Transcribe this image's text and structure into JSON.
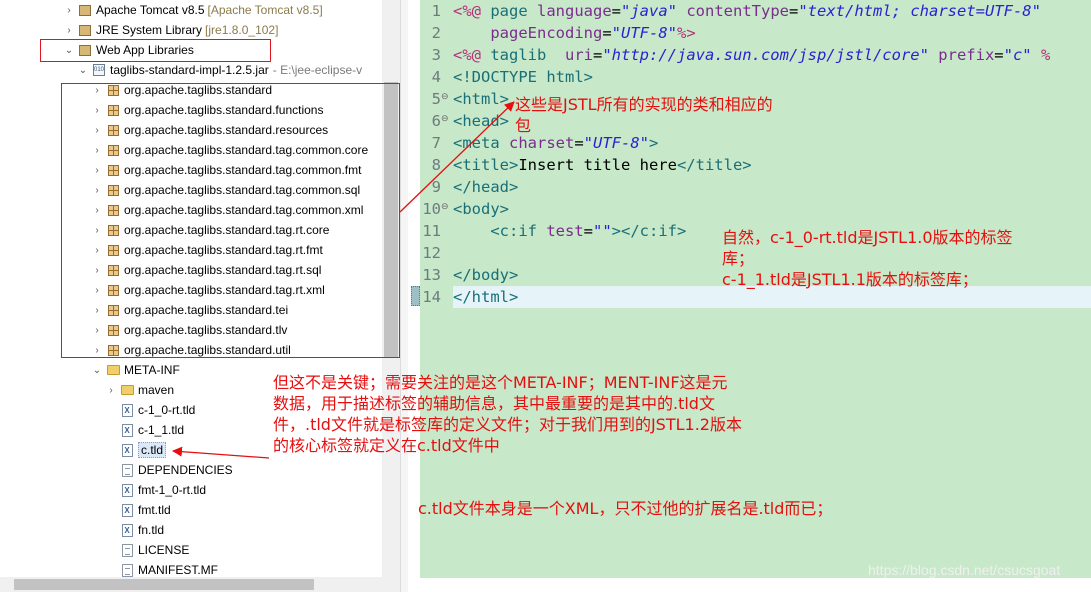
{
  "tree": {
    "items": [
      {
        "label": "Apache Tomcat v8.5",
        "hint": "[Apache Tomcat v8.5]",
        "icon": "library-icon",
        "twisty": "collapsed"
      },
      {
        "label": "JRE System Library",
        "hint": "[jre1.8.0_102]",
        "icon": "library-icon",
        "twisty": "collapsed"
      },
      {
        "label": "Web App Libraries",
        "hint": "",
        "icon": "library-icon",
        "twisty": "expanded"
      },
      {
        "label": "taglibs-standard-impl-1.2.5.jar",
        "hint": "- E:\\jee-eclipse-v",
        "icon": "jar-icon",
        "twisty": "expanded"
      },
      {
        "label": "org.apache.taglibs.standard",
        "icon": "package-icon"
      },
      {
        "label": "org.apache.taglibs.standard.functions",
        "icon": "package-icon"
      },
      {
        "label": "org.apache.taglibs.standard.resources",
        "icon": "package-icon"
      },
      {
        "label": "org.apache.taglibs.standard.tag.common.core",
        "icon": "package-icon"
      },
      {
        "label": "org.apache.taglibs.standard.tag.common.fmt",
        "icon": "package-icon"
      },
      {
        "label": "org.apache.taglibs.standard.tag.common.sql",
        "icon": "package-icon"
      },
      {
        "label": "org.apache.taglibs.standard.tag.common.xml",
        "icon": "package-icon"
      },
      {
        "label": "org.apache.taglibs.standard.tag.rt.core",
        "icon": "package-icon"
      },
      {
        "label": "org.apache.taglibs.standard.tag.rt.fmt",
        "icon": "package-icon"
      },
      {
        "label": "org.apache.taglibs.standard.tag.rt.sql",
        "icon": "package-icon"
      },
      {
        "label": "org.apache.taglibs.standard.tag.rt.xml",
        "icon": "package-icon"
      },
      {
        "label": "org.apache.taglibs.standard.tei",
        "icon": "package-icon"
      },
      {
        "label": "org.apache.taglibs.standard.tlv",
        "icon": "package-icon"
      },
      {
        "label": "org.apache.taglibs.standard.util",
        "icon": "package-icon"
      },
      {
        "label": "META-INF",
        "icon": "folder-open-icon",
        "twisty": "expanded"
      },
      {
        "label": "maven",
        "icon": "folder-icon",
        "twisty": "collapsed"
      },
      {
        "label": "c-1_0-rt.tld",
        "icon": "xml-file-icon"
      },
      {
        "label": "c-1_1.tld",
        "icon": "xml-file-icon"
      },
      {
        "label": "c.tld",
        "icon": "xml-file-icon",
        "selected": true
      },
      {
        "label": "DEPENDENCIES",
        "icon": "text-file-icon"
      },
      {
        "label": "fmt-1_0-rt.tld",
        "icon": "xml-file-icon"
      },
      {
        "label": "fmt.tld",
        "icon": "xml-file-icon"
      },
      {
        "label": "fn.tld",
        "icon": "xml-file-icon"
      },
      {
        "label": "LICENSE",
        "icon": "text-file-icon"
      },
      {
        "label": "MANIFEST.MF",
        "icon": "text-file-icon"
      }
    ]
  },
  "editor": {
    "current_line": 14,
    "lines": [
      {
        "num": "1",
        "fold": "",
        "tokens": [
          [
            "dir",
            "<%@ "
          ],
          [
            "tag",
            "page "
          ],
          [
            "attr",
            "language"
          ],
          [
            "plain",
            "="
          ],
          [
            "val",
            "\"java\""
          ],
          [
            "plain",
            " "
          ],
          [
            "attr",
            "contentType"
          ],
          [
            "plain",
            "="
          ],
          [
            "val",
            "\"text/html; charset=UTF-8\""
          ]
        ]
      },
      {
        "num": "2",
        "fold": "",
        "tokens": [
          [
            "plain",
            "    "
          ],
          [
            "attr",
            "pageEncoding"
          ],
          [
            "plain",
            "="
          ],
          [
            "val",
            "\"UTF-8\""
          ],
          [
            "dir",
            "%>"
          ]
        ]
      },
      {
        "num": "3",
        "fold": "",
        "tokens": [
          [
            "dir",
            "<%@ "
          ],
          [
            "tag",
            "taglib  "
          ],
          [
            "attr",
            "uri"
          ],
          [
            "plain",
            "="
          ],
          [
            "val",
            "\"http://java.sun.com/jsp/jstl/core\""
          ],
          [
            "plain",
            " "
          ],
          [
            "attr",
            "prefix"
          ],
          [
            "plain",
            "="
          ],
          [
            "val",
            "\"c\""
          ],
          [
            "plain",
            " "
          ],
          [
            "dir",
            "%"
          ]
        ]
      },
      {
        "num": "4",
        "fold": "",
        "tokens": [
          [
            "tag",
            "<!DOCTYPE "
          ],
          [
            "tag",
            "html"
          ],
          [
            "tag",
            ">"
          ]
        ]
      },
      {
        "num": "5",
        "fold": "⊖",
        "tokens": [
          [
            "tag",
            "<html>"
          ]
        ]
      },
      {
        "num": "6",
        "fold": "⊖",
        "tokens": [
          [
            "tag",
            "<head>"
          ]
        ]
      },
      {
        "num": "7",
        "fold": "",
        "tokens": [
          [
            "tag",
            "<meta "
          ],
          [
            "attr",
            "charset"
          ],
          [
            "plain",
            "="
          ],
          [
            "val",
            "\"UTF-8\""
          ],
          [
            "tag",
            ">"
          ]
        ]
      },
      {
        "num": "8",
        "fold": "",
        "tokens": [
          [
            "tag",
            "<title>"
          ],
          [
            "plain",
            "Insert title here"
          ],
          [
            "tag",
            "</title>"
          ]
        ]
      },
      {
        "num": "9",
        "fold": "",
        "tokens": [
          [
            "tag",
            "</head>"
          ]
        ]
      },
      {
        "num": "10",
        "fold": "⊖",
        "tokens": [
          [
            "tag",
            "<body>"
          ]
        ]
      },
      {
        "num": "11",
        "fold": "",
        "tokens": [
          [
            "plain",
            "    "
          ],
          [
            "tag",
            "<c:if "
          ],
          [
            "attr",
            "test"
          ],
          [
            "plain",
            "="
          ],
          [
            "val",
            "\"\""
          ],
          [
            "tag",
            "></c:if>"
          ]
        ]
      },
      {
        "num": "12",
        "fold": "",
        "tokens": []
      },
      {
        "num": "13",
        "fold": "",
        "tokens": [
          [
            "tag",
            "</body>"
          ]
        ]
      },
      {
        "num": "14",
        "fold": "",
        "tokens": [
          [
            "tag",
            "</html>"
          ]
        ]
      }
    ]
  },
  "annotations": {
    "note1": [
      "这些是JSTL所有的实现的类和相应的",
      "包"
    ],
    "note2": [
      "自然，c-1_0-rt.tld是JSTL1.0版本的标签",
      "库；",
      "c-1_1.tld是JSTL1.1版本的标签库；"
    ],
    "note3": [
      "但这不是关键；需要关注的是这个META-INF；MENT-INF这是元",
      "数据，用于描述标签的辅助信息，其中最重要的是其中的.tld文",
      "件，.tld文件就是标签库的定义文件；对于我们用到的JSTL1.2版本",
      "的核心标签就定义在c.tld文件中"
    ],
    "note4": [
      "c.tld文件本身是一个XML，只不过他的扩展名是.tld而已；"
    ],
    "color": "#e60e0e"
  },
  "watermark": "https://blog.csdn.net/csucsgoat"
}
